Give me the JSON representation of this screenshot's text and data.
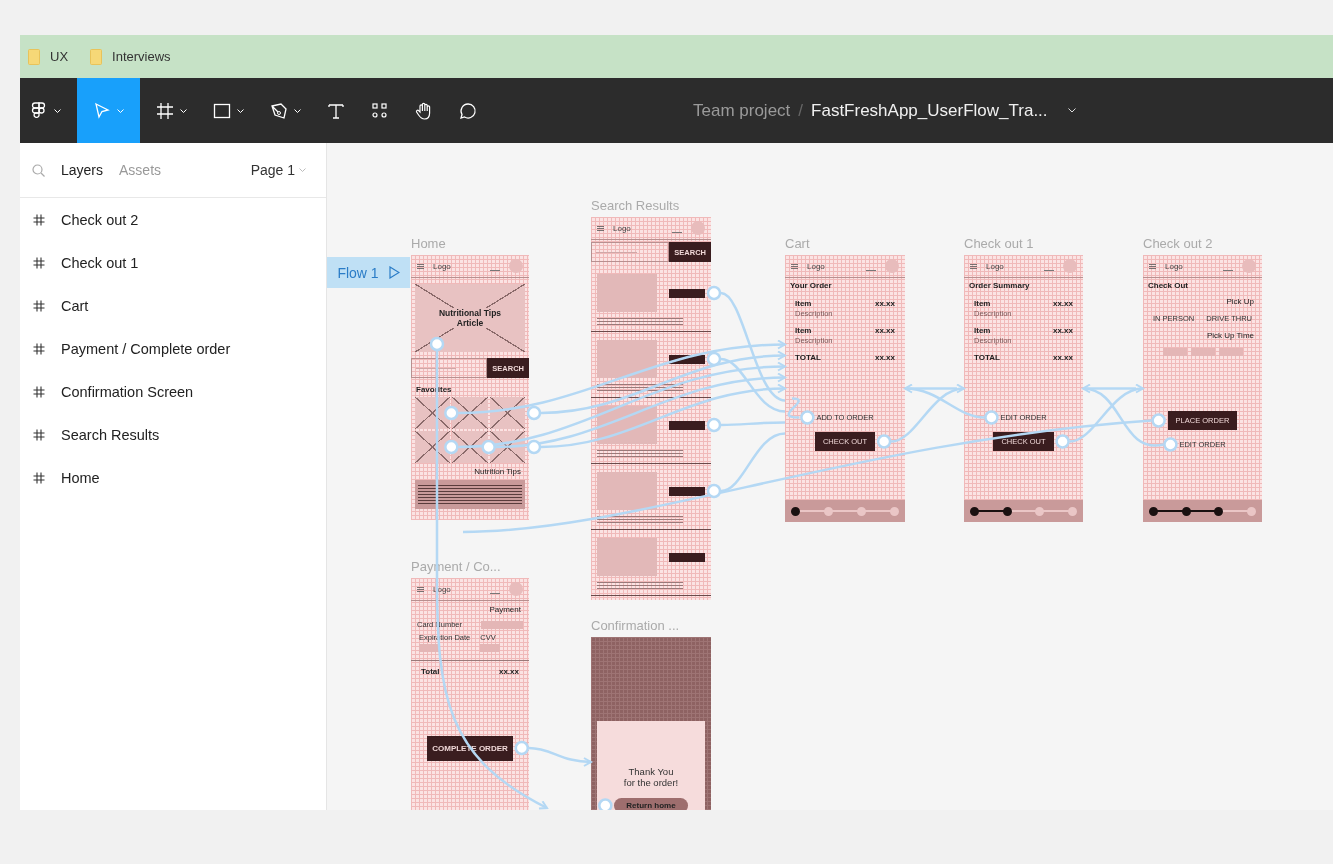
{
  "bookmarks": [
    {
      "label": "UX"
    },
    {
      "label": "Interviews"
    }
  ],
  "toolbar": {
    "tools": [
      {
        "kind": "logo",
        "selected": false
      },
      {
        "kind": "move",
        "selected": true
      },
      {
        "kind": "frame",
        "selected": false
      },
      {
        "kind": "shape",
        "selected": false
      },
      {
        "kind": "pen",
        "selected": false
      },
      {
        "kind": "text",
        "selected": false
      },
      {
        "kind": "components",
        "selected": false
      },
      {
        "kind": "hand",
        "selected": false
      },
      {
        "kind": "comment",
        "selected": false
      }
    ],
    "breadcrumb": {
      "team": "Team project",
      "separator": "/",
      "file": "FastFreshApp_UserFlow_Tra..."
    }
  },
  "sidebar": {
    "tabs": [
      {
        "label": "Layers",
        "selected": true
      },
      {
        "label": "Assets",
        "selected": false
      }
    ],
    "page": "Page 1",
    "items": [
      {
        "label": "Check out 2"
      },
      {
        "label": "Check out 1"
      },
      {
        "label": "Cart"
      },
      {
        "label": "Payment /  Complete order"
      },
      {
        "label": "Confirmation Screen"
      },
      {
        "label": "Search Results"
      },
      {
        "label": "Home"
      }
    ]
  },
  "canvas": {
    "flow": {
      "label": "Flow 1"
    },
    "frames": [
      {
        "title": "Home",
        "kind": "screen",
        "items": [
          {
            "kind": "header",
            "logo": "Logo"
          },
          {
            "kind": "image",
            "caption": "Nutritional Tips Article"
          },
          {
            "kind": "search",
            "button": "SEARCH"
          },
          {
            "kind": "label",
            "text": "Favorites"
          },
          {
            "kind": "tiles"
          },
          {
            "kind": "heading",
            "text": "Nutrition Tips"
          },
          {
            "kind": "text-block"
          }
        ]
      },
      {
        "title": "Search Results",
        "kind": "screen",
        "items": [
          {
            "kind": "header",
            "logo": "Logo"
          },
          {
            "kind": "search",
            "button": "SEARCH"
          },
          {
            "kind": "result"
          },
          {
            "kind": "result"
          },
          {
            "kind": "result"
          },
          {
            "kind": "result"
          },
          {
            "kind": "result"
          }
        ]
      },
      {
        "title": "Cart",
        "kind": "screen",
        "items": [
          {
            "kind": "header",
            "logo": "Logo"
          },
          {
            "kind": "label",
            "text": "Your Order"
          },
          {
            "kind": "row",
            "left": "Item",
            "sub": "Description",
            "right": "xx.xx"
          },
          {
            "kind": "row",
            "left": "Item",
            "sub": "Description",
            "right": "xx.xx"
          },
          {
            "kind": "row",
            "left": "TOTAL",
            "right": "xx.xx"
          }
        ],
        "actions": [
          {
            "kind": "link",
            "text": "ADD TO ORDER"
          },
          {
            "kind": "button",
            "text": "CHECK OUT"
          }
        ],
        "steps": [
          {
            "done": true
          },
          {
            "done": false
          },
          {
            "done": false
          },
          {
            "done": false
          }
        ]
      },
      {
        "title": "Check out 1",
        "kind": "screen",
        "items": [
          {
            "kind": "header",
            "logo": "Logo"
          },
          {
            "kind": "label",
            "text": "Order Summary"
          },
          {
            "kind": "row",
            "left": "Item",
            "sub": "Description",
            "right": "xx.xx"
          },
          {
            "kind": "row",
            "left": "Item",
            "sub": "Description",
            "right": "xx.xx"
          },
          {
            "kind": "row",
            "left": "TOTAL",
            "right": "xx.xx"
          }
        ],
        "actions": [
          {
            "kind": "link",
            "text": "EDIT ORDER"
          },
          {
            "kind": "button",
            "text": "CHECK OUT"
          }
        ],
        "steps": [
          {
            "done": true
          },
          {
            "done": true
          },
          {
            "done": false
          },
          {
            "done": false
          }
        ]
      },
      {
        "title": "Check out 2",
        "kind": "screen",
        "items": [
          {
            "kind": "header",
            "logo": "Logo"
          },
          {
            "kind": "label",
            "text": "Check Out"
          },
          {
            "kind": "heading",
            "text": "Pick Up"
          },
          {
            "kind": "choices",
            "options": [
              "IN PERSON",
              "DRIVE THRU"
            ]
          },
          {
            "kind": "heading",
            "text": "Pick Up Time"
          },
          {
            "kind": "slots"
          }
        ],
        "actions": [
          {
            "kind": "button",
            "text": "PLACE ORDER"
          },
          {
            "kind": "link",
            "text": "EDIT ORDER"
          }
        ],
        "steps": [
          {
            "done": true
          },
          {
            "done": true
          },
          {
            "done": true
          },
          {
            "done": false
          }
        ]
      },
      {
        "title": "Payment / Co...",
        "kind": "screen",
        "items": [
          {
            "kind": "header",
            "logo": "Logo"
          },
          {
            "kind": "heading",
            "text": "Payment"
          },
          {
            "kind": "field",
            "text": "Card Number"
          },
          {
            "kind": "pair",
            "fields": [
              "Expiration Date",
              "CVV"
            ]
          },
          {
            "kind": "row",
            "left": "Total",
            "right": "xx.xx"
          }
        ],
        "actions": [
          {
            "kind": "button",
            "text": "COMPLETE ORDER",
            "large": true
          }
        ]
      },
      {
        "title": "Confirmation ...",
        "kind": "message",
        "items": [
          {
            "kind": "panel",
            "lines": [
              "Thank You",
              "for the order!"
            ],
            "button": "Return home"
          }
        ]
      }
    ]
  }
}
